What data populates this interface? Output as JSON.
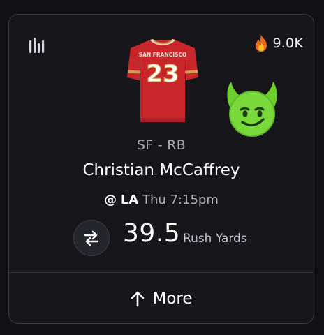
{
  "card": {
    "stats_icon": "bar-chart-icon",
    "heat": {
      "icon": "fire-icon",
      "count": "9.0K"
    },
    "jersey": {
      "team_text": "SAN FRANCISCO",
      "number": "23",
      "color": "#c8262b",
      "trim": "#c9a04b"
    },
    "emoji": "smiling-imp-emoji",
    "team_position": "SF - RB",
    "player_name": "Christian McCaffrey",
    "matchup": {
      "at": "@",
      "opponent": "LA",
      "time": "Thu 7:15pm"
    },
    "swap_icon": "swap-arrows-icon",
    "line": {
      "value": "39.5",
      "stat": "Rush Yards"
    },
    "more": {
      "icon": "arrow-up-icon",
      "label": "More"
    }
  }
}
